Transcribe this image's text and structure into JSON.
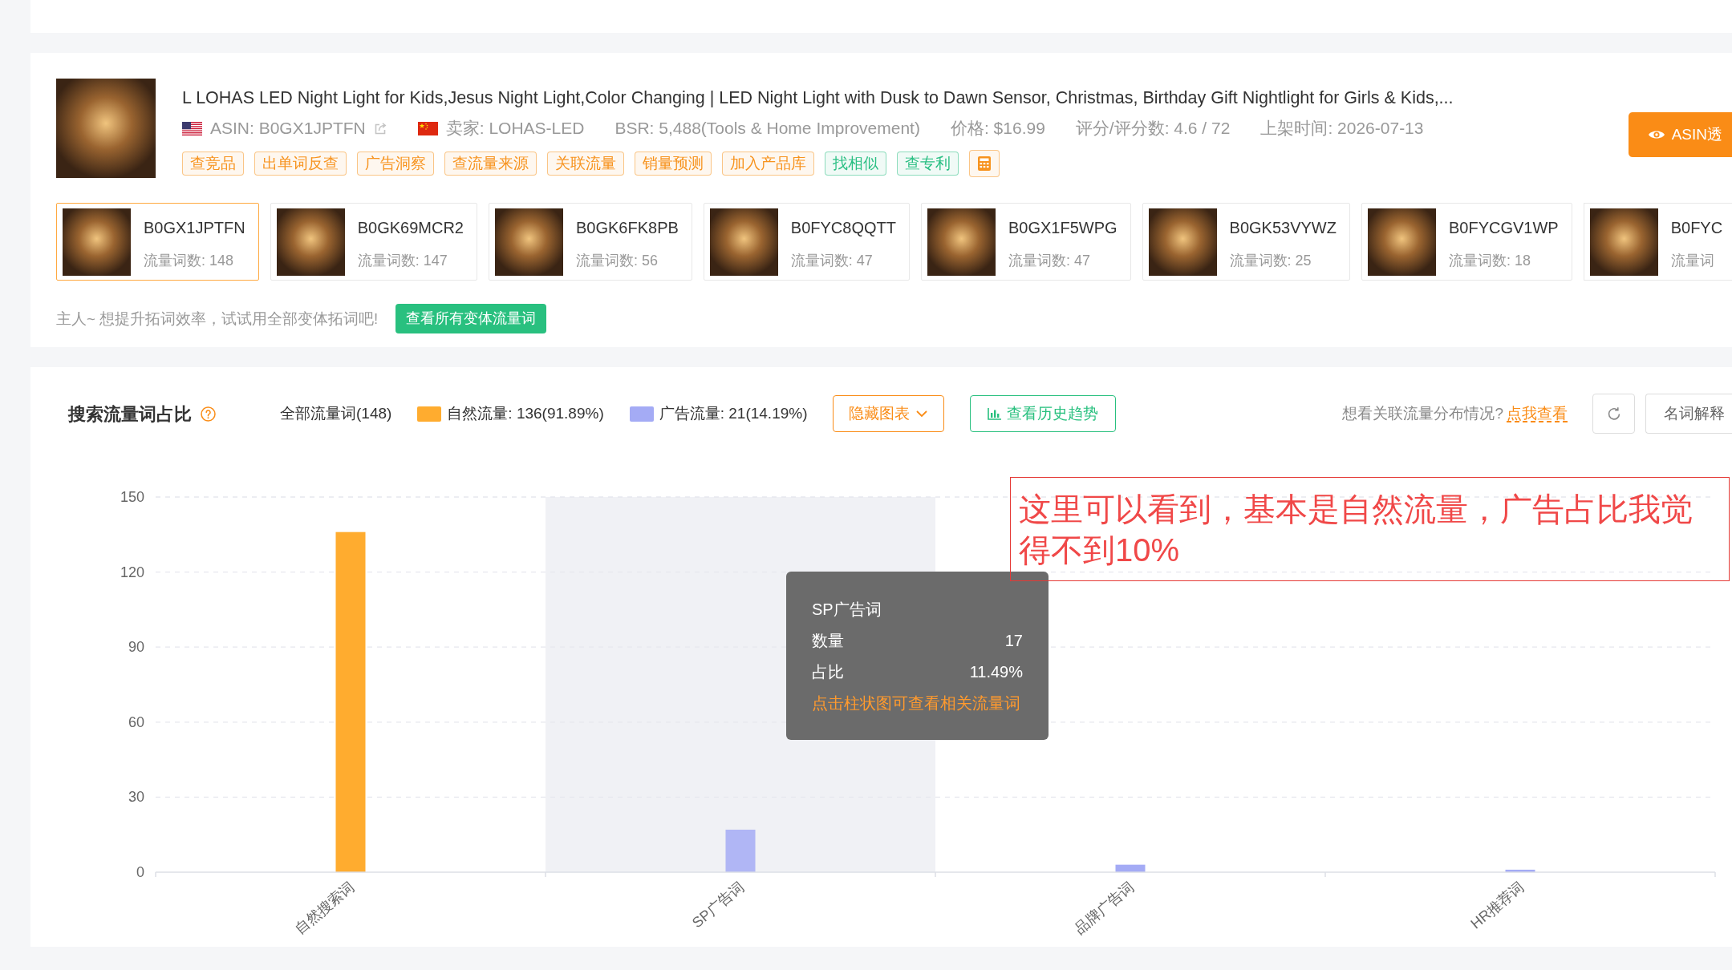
{
  "product": {
    "title": "L LOHAS LED Night Light for Kids,Jesus Night Light,Color Changing | LED Night Light with Dusk to Dawn Sensor, Christmas, Birthday Gift Nightlight for Girls & Kids,...",
    "meta": [
      {
        "kind": "asin",
        "text": "ASIN: B0GX1JPTFN"
      },
      {
        "kind": "seller",
        "text": "卖家: LOHAS-LED"
      },
      {
        "kind": "plain",
        "text": "BSR: 5,488(Tools & Home Improvement)"
      },
      {
        "kind": "plain",
        "text": "价格: $16.99"
      },
      {
        "kind": "plain",
        "text": "评分/评分数: 4.6 / 72"
      },
      {
        "kind": "plain",
        "text": "上架时间: 2026-07-13"
      }
    ],
    "tags": [
      {
        "kind": "text",
        "label": "查竞品",
        "color": "#f7931e"
      },
      {
        "kind": "text",
        "label": "出单词反查",
        "color": "#f7931e"
      },
      {
        "kind": "text",
        "label": "广告洞察",
        "color": "#f7931e"
      },
      {
        "kind": "text",
        "label": "查流量来源",
        "color": "#f7931e"
      },
      {
        "kind": "text",
        "label": "关联流量",
        "color": "#f7931e"
      },
      {
        "kind": "text",
        "label": "销量预测",
        "color": "#f7931e"
      },
      {
        "kind": "text",
        "label": "加入产品库",
        "color": "#f7931e"
      },
      {
        "kind": "text",
        "label": "找相似",
        "color": "#29bf83"
      },
      {
        "kind": "text",
        "label": "查专利",
        "color": "#29bf83"
      },
      {
        "kind": "calculator",
        "color": "#f7931e"
      }
    ],
    "action_button": "ASIN透"
  },
  "variants": {
    "items": [
      {
        "asin": "B0GX1JPTFN",
        "count": "流量词数: 148",
        "selected": true
      },
      {
        "asin": "B0GK69MCR2",
        "count": "流量词数: 147",
        "selected": false
      },
      {
        "asin": "B0GK6FK8PB",
        "count": "流量词数: 56",
        "selected": false
      },
      {
        "asin": "B0FYC8QQTT",
        "count": "流量词数: 47",
        "selected": false
      },
      {
        "asin": "B0GX1F5WPG",
        "count": "流量词数: 47",
        "selected": false
      },
      {
        "asin": "B0GK53VYWZ",
        "count": "流量词数: 25",
        "selected": false
      },
      {
        "asin": "B0FYCGV1WP",
        "count": "流量词数: 18",
        "selected": false
      },
      {
        "asin": "B0FYC",
        "count": "流量词",
        "selected": false
      }
    ],
    "hint": "主人~ 想提升拓词效率，试试用全部变体拓词吧!",
    "button": "查看所有变体流量词"
  },
  "traffic": {
    "title": "搜索流量词占比",
    "total": "全部流量词(148)",
    "legend": [
      {
        "label": "自然流量: 136(91.89%)",
        "color": "#ffac2f"
      },
      {
        "label": "广告流量: 21(14.19%)",
        "color": "#a4abf5"
      }
    ],
    "hide_button": "隐藏图表",
    "history_button": "查看历史趋势",
    "question": "想看关联流量分布情况?",
    "link": "点我查看",
    "glossary_button": "名词解释",
    "chart_data": {
      "type": "bar",
      "categories": [
        "自然搜索词",
        "SP广告词",
        "品牌广告词",
        "HR推荐词"
      ],
      "series": [
        {
          "color": "#ffac2f",
          "values": [
            136,
            null,
            null,
            null
          ]
        },
        {
          "color": "#a4abf5",
          "values": [
            null,
            17,
            3,
            1
          ]
        }
      ],
      "ylim": [
        0,
        150
      ],
      "yticks": [
        0,
        30,
        60,
        90,
        120,
        150
      ],
      "stacked": true,
      "grid": true
    },
    "hover_bands": [
      {
        "selected": false
      },
      {
        "selected": true
      },
      {
        "selected": false
      },
      {
        "selected": false
      }
    ],
    "tooltip": {
      "title": "SP广告词",
      "rows": [
        {
          "label": "数量",
          "value": "17"
        },
        {
          "label": "占比",
          "value": "11.49%"
        }
      ],
      "hint": "点击柱状图可查看相关流量词"
    },
    "annotation": "这里可以看到，基本是自然流量，广告占比我觉得不到10%"
  }
}
